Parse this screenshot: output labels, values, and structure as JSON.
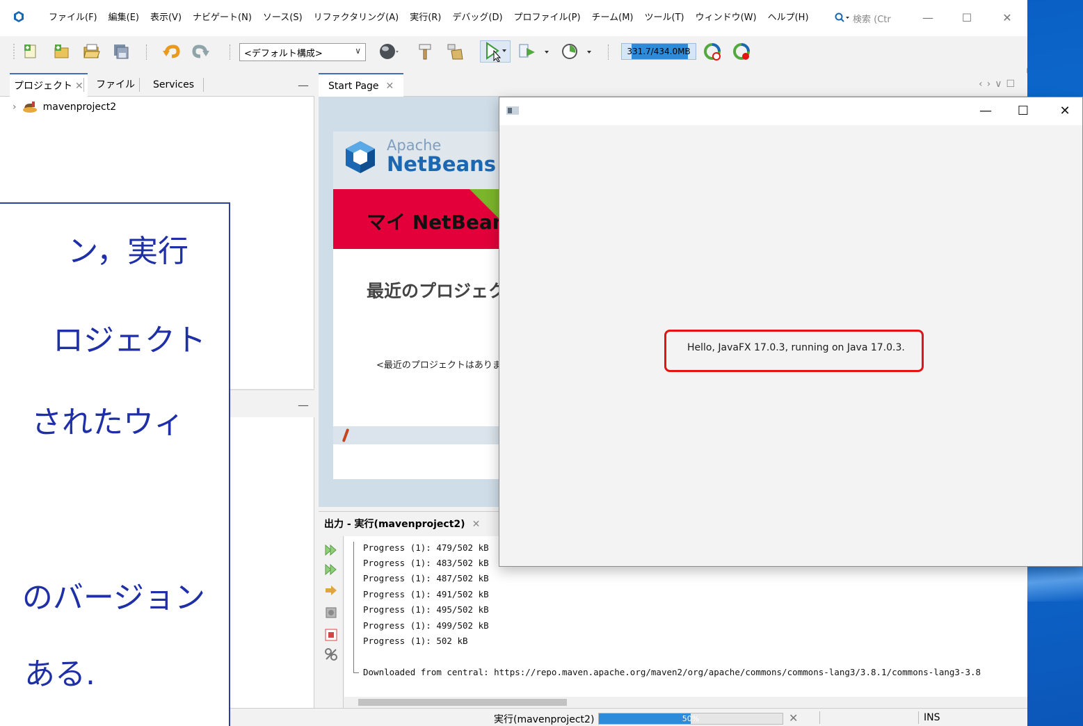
{
  "ide": {
    "menu": [
      "ファイル(F)",
      "編集(E)",
      "表示(V)",
      "ナビゲート(N)",
      "ソース(S)",
      "リファクタリング(A)",
      "実行(R)",
      "デバッグ(D)",
      "プロファイル(P)",
      "チーム(M)",
      "ツール(T)",
      "ウィンドウ(W)",
      "ヘルプ(H)"
    ],
    "search_placeholder": "検索 (Ctr",
    "config_select": "<デフォルト構成>",
    "memory_label": "331.7/434.0MB",
    "memory_fraction": 0.76,
    "left_tabs": [
      "プロジェクト",
      "ファイル",
      "Services"
    ],
    "project_name": "mavenproject2",
    "editor_tab": "Start Page"
  },
  "start_page": {
    "brand_small": "Apache",
    "brand_large": "NetBeans",
    "banner_title": "マイ NetBeans",
    "recent_title": "最近のプロジェクト",
    "recent_empty": "<最近のプロジェクトはありません>"
  },
  "output": {
    "tab_label": "出力 - 実行(mavenproject2)",
    "lines": [
      "Progress (1): 479/502 kB",
      "Progress (1): 483/502 kB",
      "Progress (1): 487/502 kB",
      "Progress (1): 491/502 kB",
      "Progress (1): 495/502 kB",
      "Progress (1): 499/502 kB",
      "Progress (1): 502 kB"
    ],
    "download_line": "Downloaded from central: https://repo.maven.apache.org/maven2/org/apache/commons/commons-lang3/3.8.1/commons-lang3-3.8"
  },
  "status": {
    "task": "実行(mavenproject2)",
    "progress_percent": 50,
    "progress_label": "50%",
    "insert_mode": "INS"
  },
  "fx_window": {
    "message": "Hello, JavaFX 17.0.3, running on Java 17.0.3."
  },
  "callout": {
    "lines": [
      "ン，実行",
      "ロジェクト",
      "されたウィ",
      "のバージョン",
      "ある."
    ]
  },
  "colors": {
    "accent": "#2e8bd9",
    "highlight": "#e21414",
    "callout_text": "#1f2fa6",
    "banner": "#e3003a"
  }
}
